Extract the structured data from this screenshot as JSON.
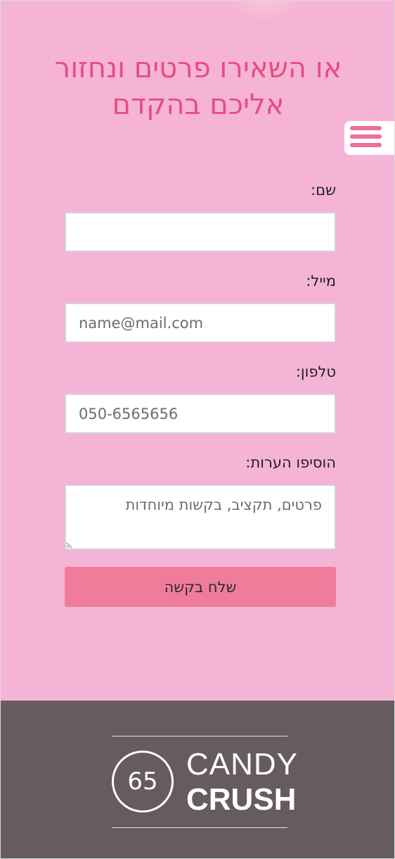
{
  "header": {
    "headline": "או השאירו פרטים ונחזור אליכם בהקדם"
  },
  "menu": {
    "icon": "hamburger-menu-icon"
  },
  "form": {
    "name_label": "שם:",
    "name_value": "",
    "name_placeholder": "",
    "email_label": "מייל:",
    "email_placeholder": "name@mail.com",
    "phone_label": "טלפון:",
    "phone_placeholder": "050-6565656",
    "notes_label": "הוסיפו הערות:",
    "notes_placeholder": "פרטים, תקציב, בקשות מיוחדות",
    "submit_label": "שלח בקשה"
  },
  "footer": {
    "logo_number": "65",
    "logo_word1": "CANDY",
    "logo_word2": "CRUSH"
  },
  "colors": {
    "page_background": "#f5b4d6",
    "headline": "#e84c7e",
    "menu_bars": "#ef6f9a",
    "submit_button": "#f07c9c",
    "footer_background": "#665b5e"
  }
}
